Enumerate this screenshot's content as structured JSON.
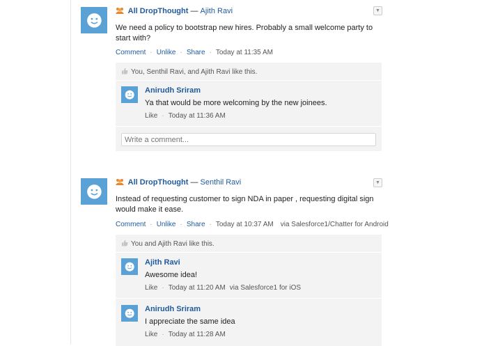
{
  "colors": {
    "link": "#1f5a9e",
    "avatar_bg": "#5aa2d6",
    "comment_bg": "#f3f3f3"
  },
  "posts": [
    {
      "group": "All DropThought",
      "separator": "—",
      "author": "Ajith Ravi",
      "body": "We need a policy to bootstrap new hires. Probably a small welcome party to start with?",
      "actions": {
        "comment": "Comment",
        "unlike": "Unlike",
        "share": "Share",
        "timestamp": "Today at 11:35 AM",
        "via": ""
      },
      "likes": "You, Senthil Ravi, and Ajith Ravi like this.",
      "comments": [
        {
          "author": "Anirudh Sriram",
          "text": "Ya that would be more welcoming by the new joinees.",
          "like": "Like",
          "timestamp": "Today at 11:36 AM",
          "via": ""
        }
      ],
      "comment_placeholder": "Write a comment..."
    },
    {
      "group": "All DropThought",
      "separator": "—",
      "author": "Senthil Ravi",
      "body": "Instead of requesting customer to sign NDA in paper , requesting digital sign would make it ease.",
      "actions": {
        "comment": "Comment",
        "unlike": "Unlike",
        "share": "Share",
        "timestamp": "Today at 10:37 AM",
        "via": "via Salesforce1/Chatter for Android"
      },
      "likes": "You and Ajith Ravi like this.",
      "comments": [
        {
          "author": "Ajith Ravi",
          "text": "Awesome idea!",
          "like": "Like",
          "timestamp": "Today at 11:20 AM",
          "via": "via Salesforce1 for iOS"
        },
        {
          "author": "Anirudh Sriram",
          "text": "I appreciate the same idea",
          "like": "Like",
          "timestamp": "Today at 11:28 AM",
          "via": ""
        }
      ]
    }
  ],
  "icons": {
    "avatar": "smiley-avatar-icon",
    "group": "group-icon",
    "like": "thumbs-up-icon",
    "menu": "chevron-down-icon"
  }
}
